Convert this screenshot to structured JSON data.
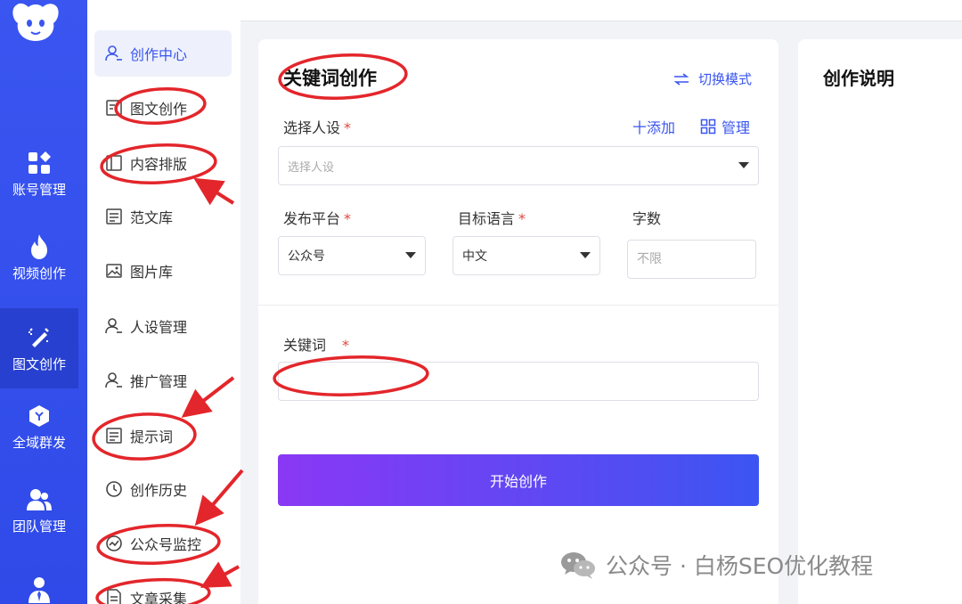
{
  "rail": {
    "items": [
      {
        "label": "账号管理",
        "icon": "grid-icon"
      },
      {
        "label": "视频创作",
        "icon": "flame-icon"
      },
      {
        "label": "图文创作",
        "icon": "magic-pen-icon",
        "active": true
      },
      {
        "label": "全域群发",
        "icon": "hexagon-icon"
      },
      {
        "label": "团队管理",
        "icon": "team-icon"
      },
      {
        "label": "",
        "icon": "person-tie-icon"
      }
    ]
  },
  "submenu": {
    "items": [
      {
        "label": "创作中心",
        "icon": "user-icon",
        "active": true
      },
      {
        "label": "图文创作",
        "icon": "doc-image-icon"
      },
      {
        "label": "内容排版",
        "icon": "layout-icon"
      },
      {
        "label": "范文库",
        "icon": "library-icon"
      },
      {
        "label": "图片库",
        "icon": "image-icon"
      },
      {
        "label": "人设管理",
        "icon": "user-icon"
      },
      {
        "label": "推广管理",
        "icon": "user-icon"
      },
      {
        "label": "提示词",
        "icon": "library-icon"
      },
      {
        "label": "创作历史",
        "icon": "clock-icon"
      },
      {
        "label": "公众号监控",
        "icon": "monitor-icon"
      },
      {
        "label": "文章采集",
        "icon": "file-icon"
      }
    ]
  },
  "card": {
    "title": "关键词创作",
    "switch_mode": "切换模式",
    "persona_label": "选择人设",
    "add_label": "十添加",
    "manage_label": "管理",
    "persona_placeholder": "选择人设",
    "platform_label": "发布平台",
    "platform_value": "公众号",
    "language_label": "目标语言",
    "language_value": "中文",
    "wordcount_label": "字数",
    "wordcount_placeholder": "不限",
    "keyword_label": "关键词",
    "keyword_value": "",
    "required_mark": "*",
    "start_button": "开始创作"
  },
  "right_card": {
    "title": "创作说明"
  },
  "watermark": {
    "text": "公众号 · 白杨SEO优化教程"
  },
  "colors": {
    "accent": "#3a55f0",
    "rail": "#3a55f0",
    "annotation": "#e3262b",
    "button_start": "#8a38f4",
    "button_end": "#3c55f2"
  }
}
